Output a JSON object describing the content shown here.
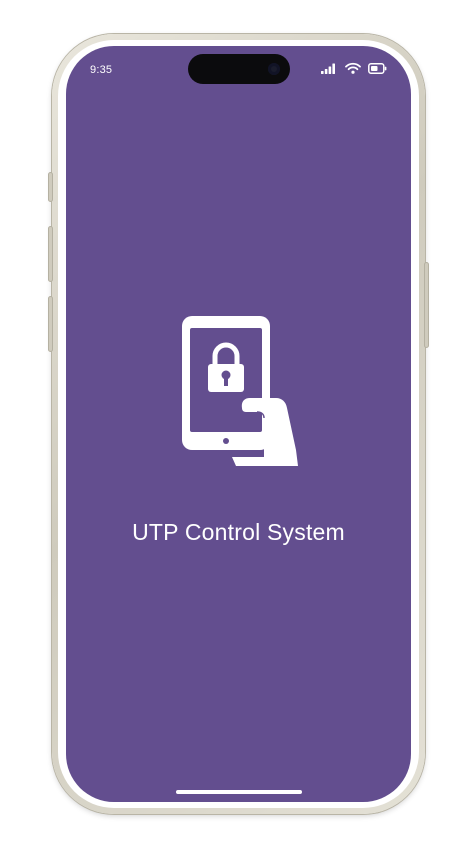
{
  "status_bar": {
    "time": "9:35",
    "icons": [
      "signal-bars-icon",
      "wifi-icon",
      "battery-icon"
    ]
  },
  "splash": {
    "logo_icon": "hand-holding-tablet-lock-icon",
    "title": "UTP Control System"
  },
  "colors": {
    "screen_background": "#634e8f",
    "foreground": "#ffffff",
    "frame": "#d9d6ca"
  }
}
